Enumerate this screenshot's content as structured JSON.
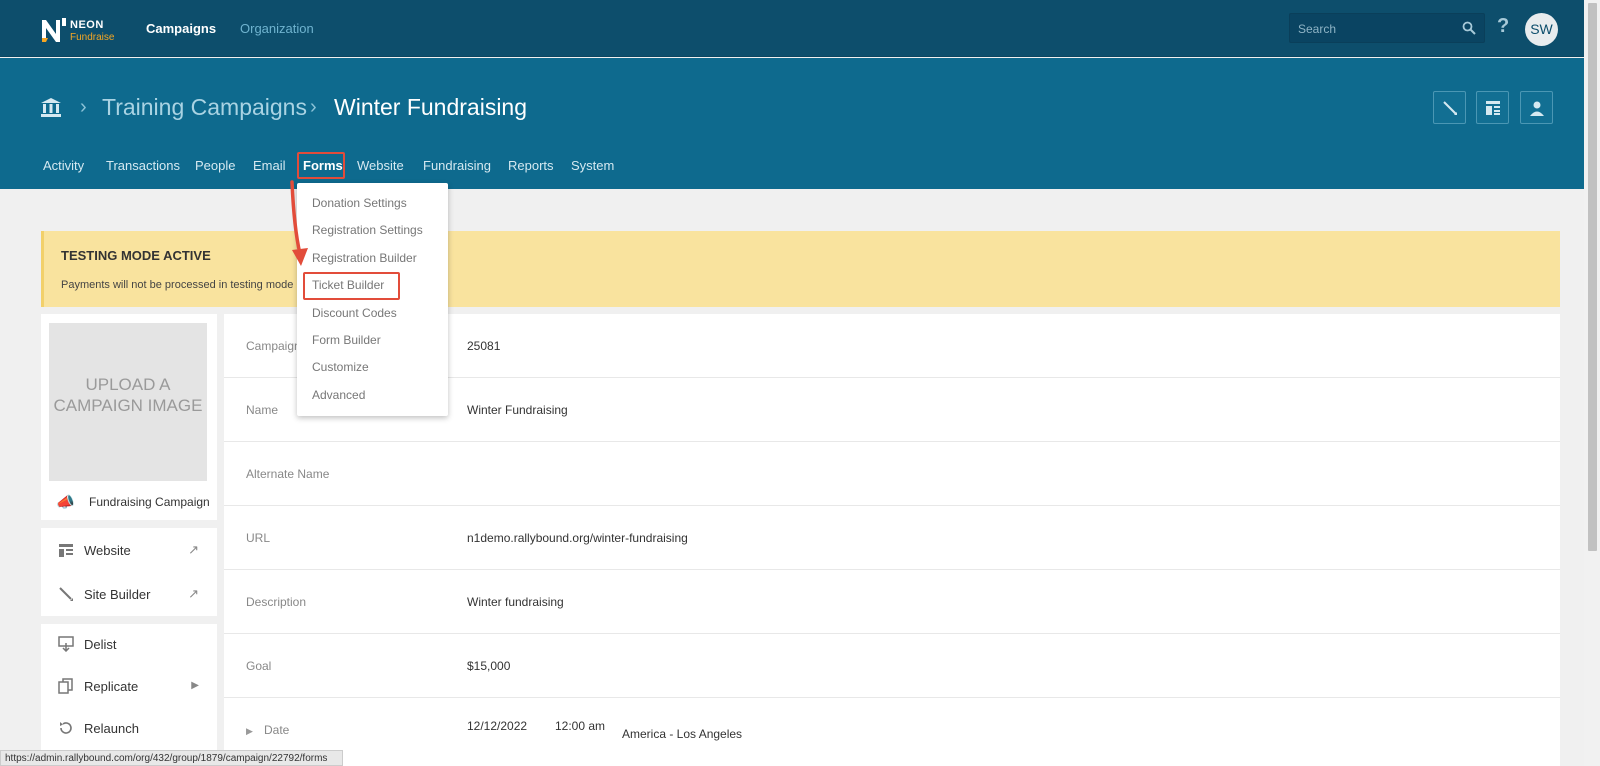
{
  "topbar": {
    "logo_neon": "NEON",
    "logo_fundraise": "Fundraise",
    "nav": {
      "campaigns": "Campaigns",
      "organization": "Organization"
    },
    "search": {
      "placeholder": "Search"
    },
    "help": "?",
    "avatar_initials": "SW"
  },
  "header": {
    "breadcrumb": [
      {
        "label": "Training Campaigns"
      },
      {
        "label": "Winter Fundraising"
      }
    ],
    "separator": "›",
    "nav": [
      "Activity",
      "Transactions",
      "People",
      "Email",
      "Forms",
      "Website",
      "Fundraising",
      "Reports",
      "System"
    ]
  },
  "forms_menu": [
    "Donation Settings",
    "Registration Settings",
    "Registration Builder",
    "Ticket Builder",
    "Discount Codes",
    "Form Builder",
    "Customize",
    "Advanced"
  ],
  "banner": {
    "title": "TESTING MODE ACTIVE",
    "text": "Payments will not be processed in testing mode"
  },
  "campaign": {
    "upload_text": "UPLOAD A CAMPAIGN IMAGE",
    "type_label": "Fundraising Campaign"
  },
  "sidebar": {
    "links": [
      {
        "label": "Website",
        "icon": "website-icon"
      },
      {
        "label": "Site Builder",
        "icon": "site-builder-icon"
      }
    ],
    "actions": [
      {
        "label": "Delist",
        "icon": "delist-icon"
      },
      {
        "label": "Replicate",
        "icon": "replicate-icon"
      },
      {
        "label": "Relaunch",
        "icon": "relaunch-icon"
      }
    ]
  },
  "details": {
    "rows": [
      {
        "label": "Campaign ID",
        "value": "25081"
      },
      {
        "label": "Name",
        "value": "Winter Fundraising"
      },
      {
        "label": "Alternate Name",
        "value": ""
      },
      {
        "label": "URL",
        "value": "n1demo.rallybound.org/winter-fundraising"
      },
      {
        "label": "Description",
        "value": "Winter fundraising"
      },
      {
        "label": "Goal",
        "value": "$15,000"
      }
    ],
    "date": {
      "label": "Date",
      "date": "12/12/2022",
      "time": "12:00 am",
      "timezone": "America - Los Angeles"
    }
  },
  "statusbar": "https://admin.rallybound.com/org/432/group/1879/campaign/22792/forms",
  "colors": {
    "topbar": "#0d4e6c",
    "header": "#0e6a8e",
    "banner": "#f9e39e",
    "highlight": "#e24c3a",
    "accent": "#f5a623"
  }
}
